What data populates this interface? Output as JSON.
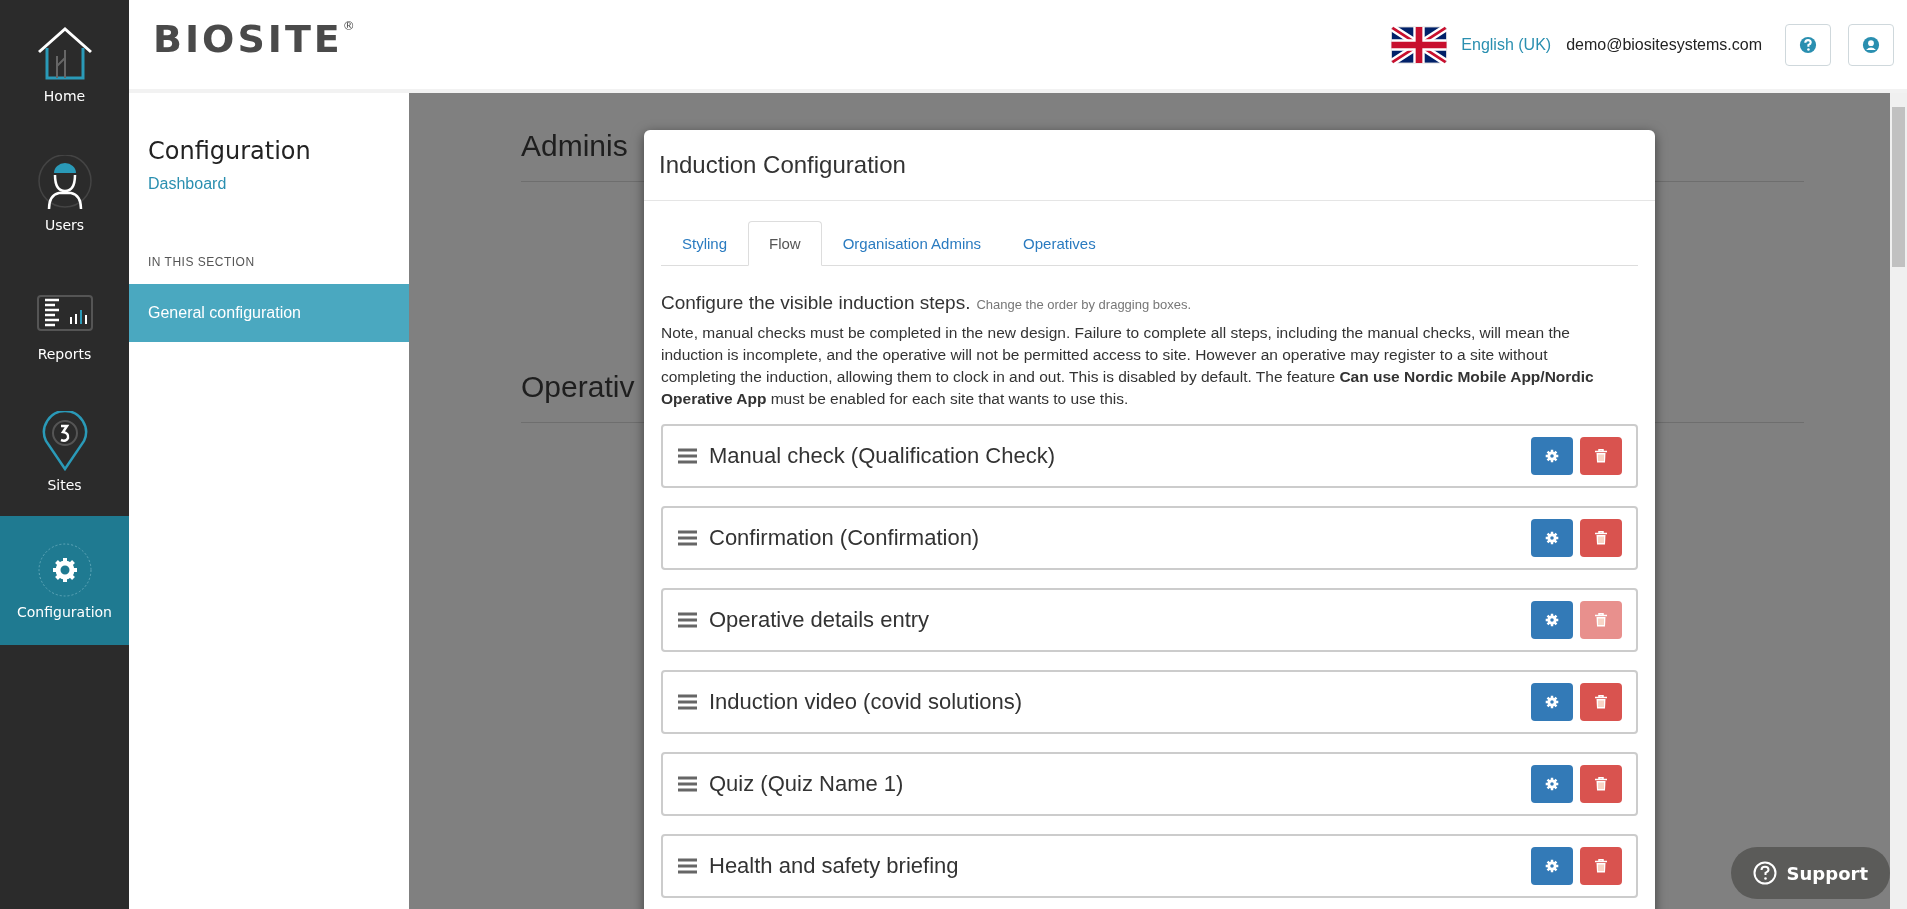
{
  "nav": {
    "items": [
      {
        "kind": "home",
        "label": "Home",
        "selected": false
      },
      {
        "kind": "users",
        "label": "Users",
        "selected": false
      },
      {
        "kind": "reports",
        "label": "Reports",
        "selected": false
      },
      {
        "kind": "sites",
        "label": "Sites",
        "selected": false
      },
      {
        "kind": "configuration",
        "label": "Configuration",
        "selected": true
      }
    ]
  },
  "header": {
    "logo": "BIOSITE",
    "logo_mark": "®",
    "language": "English (UK)",
    "email": "demo@biositesystems.com"
  },
  "sidebar": {
    "title": "Configuration",
    "link": "Dashboard",
    "section_label": "IN THIS SECTION",
    "items": [
      {
        "label": "General configuration",
        "selected": true
      }
    ]
  },
  "background": {
    "headings": [
      "Adminis",
      "Operativ"
    ]
  },
  "modal": {
    "title": "Induction Configuration",
    "tabs": [
      {
        "label": "Styling",
        "selected": false
      },
      {
        "label": "Flow",
        "selected": true
      },
      {
        "label": "Organisation Admins",
        "selected": false
      },
      {
        "label": "Operatives",
        "selected": false
      }
    ],
    "heading": "Configure the visible induction steps.",
    "hint": "Change the order by dragging boxes.",
    "note": "Note, manual checks must be completed in the new design. Failure to complete all steps, including the manual checks, will mean the induction is incomplete, and the operative will not be permitted access to site. However an operative may register to a site without completing the induction, allowing them to clock in and out. This is disabled by default. The feature **Can use Nordic Mobile App/Nordic Operative App** must be enabled for each site that wants to use this.",
    "steps": [
      {
        "label": "Manual check (Qualification Check)",
        "delete_disabled": false
      },
      {
        "label": "Confirmation (Confirmation)",
        "delete_disabled": false
      },
      {
        "label": "Operative details entry",
        "delete_disabled": true
      },
      {
        "label": "Induction video (covid solutions)",
        "delete_disabled": false
      },
      {
        "label": "Quiz (Quiz Name 1)",
        "delete_disabled": false
      },
      {
        "label": "Health and safety briefing",
        "delete_disabled": false
      }
    ]
  },
  "support": {
    "label": "Support"
  }
}
